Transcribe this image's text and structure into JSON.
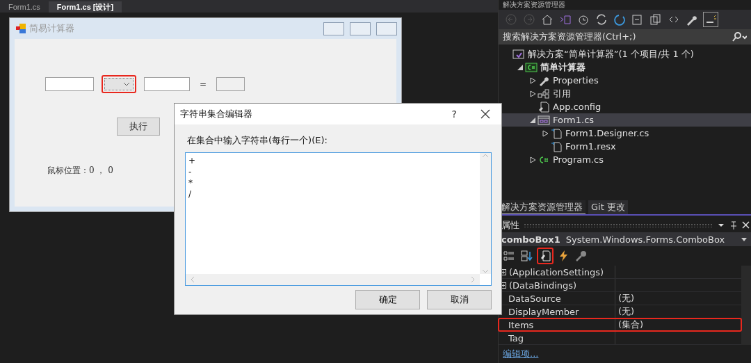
{
  "editor_tabs": [
    {
      "label": "Form1.cs",
      "selected": false
    },
    {
      "label": "Form1.cs [设计]",
      "selected": true
    }
  ],
  "designer_form": {
    "title": "简易计算器",
    "operator_highlighted": true,
    "run_button": "执行",
    "equals": "=",
    "mouse_label": "鼠标位置：0 ， 0"
  },
  "dialog": {
    "title": "字符串集合编辑器",
    "help": "?",
    "prompt": "在集合中输入字符串(每行一个)(E):",
    "lines": [
      "+",
      "-",
      "*",
      "/"
    ],
    "buttons": [
      "确定",
      "取消"
    ]
  },
  "solution_explorer": {
    "title": "解决方案资源管理器",
    "search": {
      "placeholder": "搜索解决方案资源管理器(Ctrl+;)"
    },
    "tree": [
      {
        "label": "解决方案“简单计算器”(1 个项目/共 1 个)",
        "kind": "solution",
        "selected": false,
        "children": [
          {
            "label": "简单计算器",
            "kind": "project",
            "expanded": true,
            "selected": false,
            "children": [
              {
                "label": "Properties",
                "kind": "wrench",
                "expanded": false,
                "selected": false
              },
              {
                "label": "引用",
                "kind": "references",
                "expanded": false,
                "selected": false
              },
              {
                "label": "App.config",
                "kind": "config",
                "selected": false
              },
              {
                "label": "Form1.cs",
                "kind": "form",
                "expanded": true,
                "selected": true,
                "children": [
                  {
                    "label": "Form1.Designer.cs",
                    "kind": "file",
                    "expanded": false,
                    "selected": false
                  },
                  {
                    "label": "Form1.resx",
                    "kind": "file",
                    "selected": false
                  }
                ]
              },
              {
                "label": "Program.cs",
                "kind": "csharp",
                "expanded": false,
                "selected": false
              }
            ]
          }
        ]
      }
    ]
  },
  "bottom_tabs": [
    {
      "label": "解决方案资源管理器",
      "selected": true
    },
    {
      "label": "Git 更改",
      "selected": false
    }
  ],
  "properties": {
    "title": "属性",
    "object": "comboBox1",
    "type": "System.Windows.Forms.ComboBox",
    "tools": [
      {
        "kind": "categorized",
        "highlighted": false
      },
      {
        "kind": "alphabetical",
        "highlighted": false
      },
      {
        "kind": "properties",
        "highlighted": true
      },
      {
        "kind": "events",
        "highlighted": false
      },
      {
        "kind": "pages",
        "highlighted": false
      }
    ],
    "rows": [
      {
        "name": "(ApplicationSettings)",
        "kind": "group",
        "highlighted": false
      },
      {
        "name": "(DataBindings)",
        "kind": "group",
        "highlighted": false
      },
      {
        "name": "DataSource",
        "value": "(无)",
        "kind": "prop",
        "highlighted": false
      },
      {
        "name": "DisplayMember",
        "value": "(无)",
        "kind": "prop",
        "highlighted": false
      },
      {
        "name": "Items",
        "value": "(集合)",
        "kind": "prop",
        "highlighted": true
      },
      {
        "name": "Tag",
        "kind": "prop",
        "highlighted": false
      }
    ],
    "footer_link": "编辑项..."
  }
}
